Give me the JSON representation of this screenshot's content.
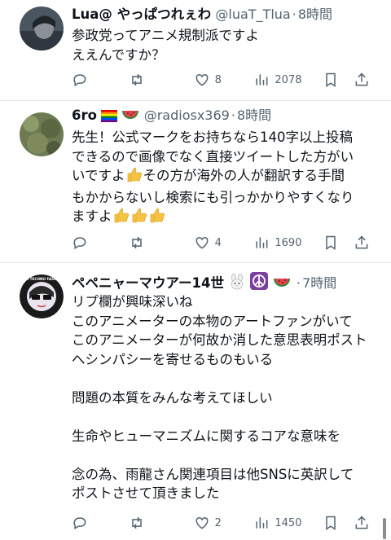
{
  "tweets": [
    {
      "name": "Lua@ やっぱつれぇわ",
      "handle": "@luaT_Tlua",
      "time": "8時間",
      "text": "参政党ってアニメ規制派ですよ\nええんですか？",
      "likes": "8",
      "views": "2078"
    },
    {
      "name": "6ro",
      "name_emojis": [
        "rainbow-flag",
        "watermelon"
      ],
      "handle": "@radiosx369",
      "time": "8時間",
      "text_a": "先生！公式マークをお持ちなら140字以上投稿\nできるので画像でなく直接ツイートした方がい\nいですよ",
      "text_b": "その方が海外の人が翻訳する手間\nもかからないし検索にも引っかかりやすくなり\nますよ",
      "likes": "4",
      "views": "1690"
    },
    {
      "name": "ペペニャーマウアー14世",
      "name_emojis": [
        "rabbit-face",
        "peace-symbol",
        "watermelon"
      ],
      "avatar_text": "ANTI TECHNO FASCISM",
      "time": "7時間",
      "text": "リプ欄が興味深いね\nこのアニメーターの本物のアートファンがいて\nこのアニメーターが何故か消した意思表明ポスト\nへシンパシーを寄せるものもいる\n\n問題の本質をみんな考えてほしい\n\n生命やヒューマニズムに関するコアな意味を\n\n念の為、雨龍さん関連項目は他SNSに英訳して\nポストさせて頂きました",
      "likes": "2",
      "views": "1450"
    }
  ],
  "colors": {
    "text": "#0f1419",
    "secondary": "#536471",
    "divider": "#e6e9ec"
  }
}
